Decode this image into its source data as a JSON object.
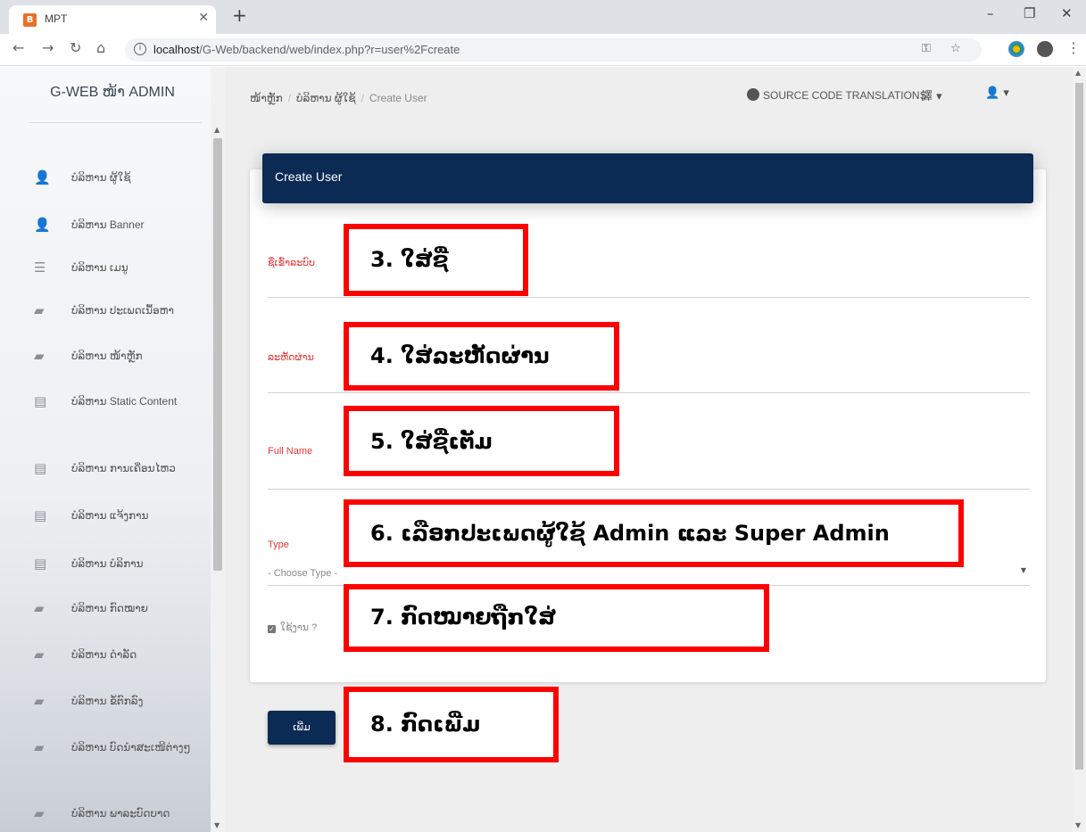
{
  "browser": {
    "tab_title": "MPT",
    "favicon_letter": "B",
    "url_host": "localhost",
    "url_path": "/G-Web/backend/web/index.php?r=user%2Fcreate"
  },
  "sidebar": {
    "brand": "G-WEB ໜ້າ ADMIN",
    "items": [
      {
        "icon": "user-icon",
        "label": "ບໍລິຫານ ຜູ້ໃຊ້"
      },
      {
        "icon": "user-icon",
        "label": "ບໍລິຫານ Banner"
      },
      {
        "icon": "list-icon",
        "label": "ບໍລິຫານ ເມນູ"
      },
      {
        "icon": "book-icon",
        "label": "ບໍລິຫານ ປະເພດເນື້ອຫາ"
      },
      {
        "icon": "book-icon",
        "label": "ບໍລິຫານ ໜ້າຫຼັກ"
      },
      {
        "icon": "newspaper-icon",
        "label": "ບໍລິຫານ Static Content"
      },
      {
        "icon": "newspaper-icon",
        "label": "ບໍລິຫານ ການເຄື່ອນໄຫວ"
      },
      {
        "icon": "newspaper-icon",
        "label": "ບໍລິຫານ ແຈ້ງການ"
      },
      {
        "icon": "newspaper-icon",
        "label": "ບໍລິຫານ ບໍລິການ"
      },
      {
        "icon": "book-icon",
        "label": "ບໍລິຫານ ກົດໝາຍ"
      },
      {
        "icon": "book-icon",
        "label": "ບໍລິຫານ ດຳລັດ"
      },
      {
        "icon": "book-icon",
        "label": "ບໍລິຫານ ຂໍ້ຕົກລົງ"
      },
      {
        "icon": "book-icon",
        "label": "ບໍລິຫານ ບົດນຳສະເໜີຕ່າງໆ"
      },
      {
        "icon": "book-icon",
        "label": "ບໍລິຫານ ພາລະບົດບາດ"
      }
    ]
  },
  "topbar": {
    "breadcrumb": [
      "ໜ້າຫຼັກ",
      "ບໍລິຫານ ຜູ້ໃຊ້",
      "Create User"
    ],
    "translations_link": "SOURCE CODE TRANSLATIONS"
  },
  "form": {
    "title": "Create User",
    "username_label": "ຊື່ເຂົ້າລະບົບ",
    "password_label": "ລະຫັດຜ່ານ",
    "fullname_label": "Full Name",
    "type_label": "Type",
    "type_placeholder": "- Choose Type -",
    "active_label": "ໃຊ້ງານ ?",
    "submit_label": "ເພີ່ມ"
  },
  "annotations": [
    "3.  ໃສ່ຊື່",
    "4.  ໃສ່ລະຫັດຜ່ານ",
    "5.  ໃສ່ຊື່ເຕັມ",
    "6.  ເລືອກປະເພດຜູ້ໃຊ້ Admin ແລະ Super Admin",
    "7.  ກົດໝາຍຖືກໃສ່",
    "8.  ກົດເພີ່ມ"
  ],
  "colors": {
    "header_bg": "#0b2a54",
    "label_red": "#e53935",
    "annotation_border": "#ff0000"
  }
}
